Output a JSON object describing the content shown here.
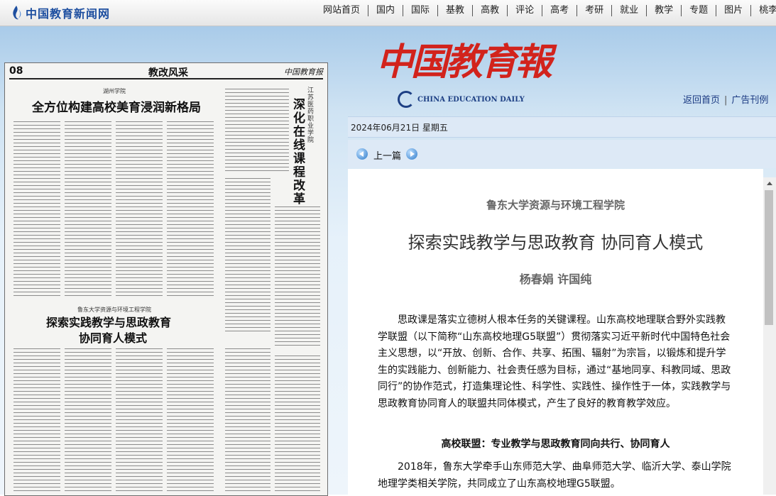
{
  "site": {
    "logo_text": "中国教育新闻网",
    "nav": [
      "网站首页",
      "国内",
      "国际",
      "基教",
      "高教",
      "评论",
      "高考",
      "考研",
      "就业",
      "教学",
      "专题",
      "图片",
      "桃李"
    ]
  },
  "epaper": {
    "page_number": "08",
    "page_title": "教改风采",
    "brand": "中国教育报",
    "kicker1": "湖州学院",
    "headline1": "全方位构建高校美育浸润新格局",
    "vertical_kicker": "江苏医药职业学院",
    "vertical_headline": "深化在线课程改革 提高教育教学质量",
    "kicker2": "鲁东大学资源与环境工程学院",
    "headline2_line1": "探索实践教学与思政教育",
    "headline2_line2": "协同育人模式"
  },
  "masthead": {
    "chinese": "中国教育報",
    "english": "CHINA EDUCATION DAILY"
  },
  "links": {
    "home": "返回首页",
    "ads": "广告刊例"
  },
  "date": "2024年06月21日  星期五",
  "pagenav": {
    "prev_label": "上一篇"
  },
  "article": {
    "subtitle": "鲁东大学资源与环境工程学院",
    "title": "探索实践教学与思政教育  协同育人模式",
    "authors": "杨春娟  许国纯",
    "para1": "　　思政课是落实立德树人根本任务的关键课程。山东高校地理联合野外实践教学联盟（以下简称“山东高校地理G5联盟”）贯彻落实习近平新时代中国特色社会主义思想，以“开放、创新、合作、共享、拓围、辐射”为宗旨，以锻炼和提升学生的实践能力、创新能力、社会责任感为目标，通过“基地同享、科教同域、思政同行”的协作范式，打造集理论性、科学性、实践性、操作性于一体，实践教学与思政教育协同育人的联盟共同体模式，产生了良好的教育教学效应。",
    "heading1": "高校联盟：专业教学与思政教育同向共行、协同育人",
    "para2": "　　2018年，鲁东大学牵手山东师范大学、曲阜师范大学、临沂大学、泰山学院地理学类相关学院，共同成立了山东高校地理G5联盟。"
  },
  "colors": {
    "masthead_red": "#d2231c",
    "link_blue": "#1b3a82",
    "brand_blue": "#1e4fa0"
  }
}
